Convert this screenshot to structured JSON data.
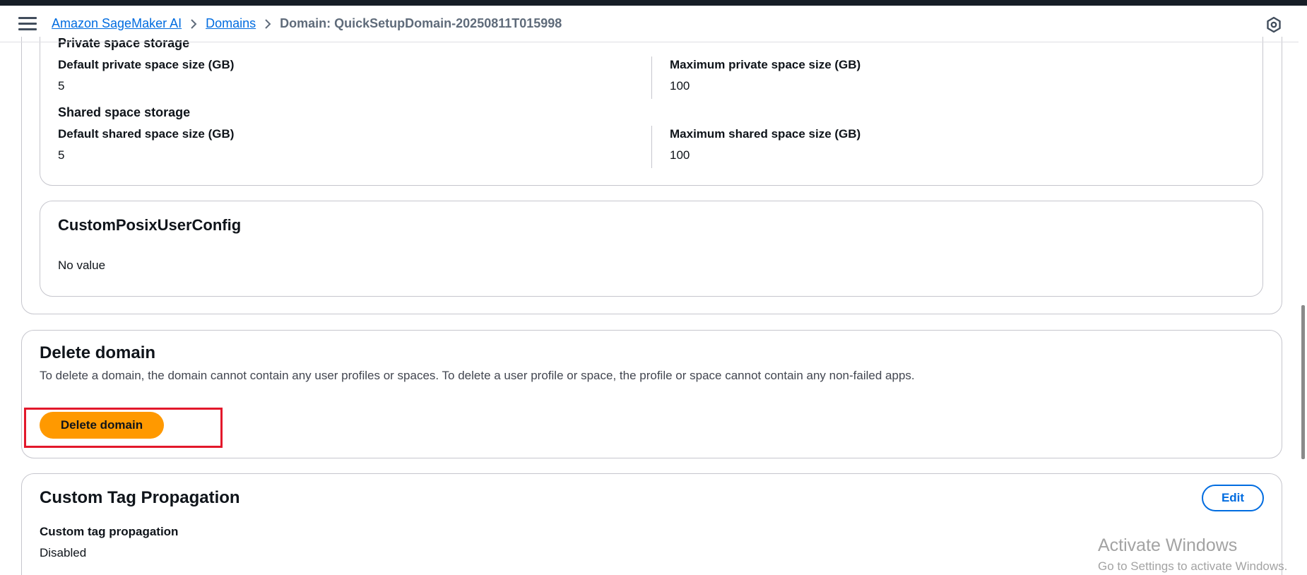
{
  "breadcrumb": {
    "items": [
      "Amazon SageMaker AI",
      "Domains"
    ],
    "current": "Domain: QuickSetupDomain-20250811T015998"
  },
  "storage": {
    "private_heading": "Private space storage",
    "default_private_label": "Default private space size (GB)",
    "default_private_value": "5",
    "max_private_label": "Maximum private space size (GB)",
    "max_private_value": "100",
    "shared_heading": "Shared space storage",
    "default_shared_label": "Default shared space size (GB)",
    "default_shared_value": "5",
    "max_shared_label": "Maximum shared space size (GB)",
    "max_shared_value": "100"
  },
  "posix": {
    "title": "CustomPosixUserConfig",
    "value": "No value"
  },
  "delete_domain": {
    "title": "Delete domain",
    "description": "To delete a domain, the domain cannot contain any user profiles or spaces. To delete a user profile or space, the profile or space cannot contain any non-failed apps.",
    "button_label": "Delete domain"
  },
  "tag_propagation": {
    "title": "Custom Tag Propagation",
    "edit_label": "Edit",
    "field_label": "Custom tag propagation",
    "field_value": "Disabled"
  },
  "watermark": {
    "line1": "Activate Windows",
    "line2": "Go to Settings to activate Windows."
  },
  "colors": {
    "link": "#006ce0",
    "primary_button": "#ff9900",
    "highlight": "#e3182b",
    "topbar": "#161d26"
  },
  "icons": [
    "menu-icon",
    "chevron-right-icon",
    "settings-icon"
  ]
}
